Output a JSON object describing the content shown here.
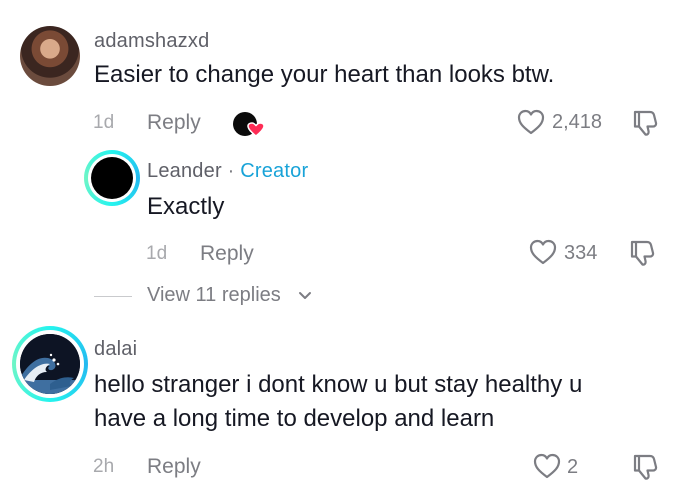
{
  "comments": [
    {
      "username": "adamshazxd",
      "text": "Easier to change your heart than looks btw.",
      "time": "1d",
      "reply_label": "Reply",
      "likes": "2,418",
      "avatar_icon": "user-avatar",
      "reaction_icon": "creator-liked-icon",
      "reply": {
        "username": "Leander",
        "separator": "·",
        "creator_label": "Creator",
        "text": "Exactly",
        "time": "1d",
        "reply_label": "Reply",
        "likes": "334"
      },
      "view_replies_label": "View 11 replies"
    },
    {
      "username": "dalai",
      "text_line1": "hello stranger i dont know u but stay healthy u",
      "text_line2": "have a long time to develop and learn",
      "time": "2h",
      "reply_label": "Reply",
      "likes": "2"
    }
  ],
  "colors": {
    "text": "#161823",
    "muted": "#7c7d83",
    "creator": "#19a3d8",
    "heart_accent": "#fe2c55",
    "ring": "#25f4ee"
  }
}
